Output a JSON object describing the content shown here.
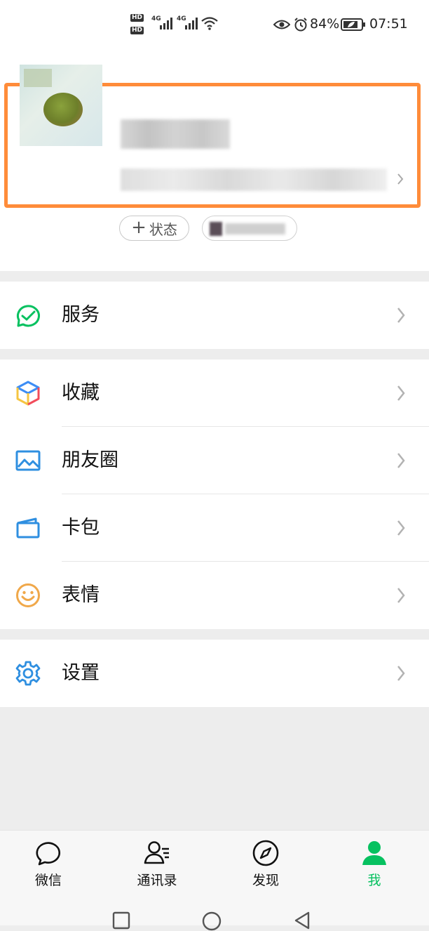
{
  "status_bar": {
    "hd1": "HD",
    "hd2": "HD",
    "net1": "4G",
    "net2": "4G",
    "battery": "84%",
    "time": "07:51"
  },
  "profile": {
    "status_button": "状态"
  },
  "menu": {
    "services": "服务",
    "favorites": "收藏",
    "moments": "朋友圈",
    "cards": "卡包",
    "stickers": "表情",
    "settings": "设置"
  },
  "tabbar": [
    {
      "label": "微信",
      "icon": "chat-icon"
    },
    {
      "label": "通讯录",
      "icon": "contacts-icon"
    },
    {
      "label": "发现",
      "icon": "compass-icon"
    },
    {
      "label": "我",
      "icon": "person-icon",
      "active": true
    }
  ],
  "colors": {
    "accent": "#07c160",
    "highlight_border": "#ff8c3a",
    "background": "#ededed"
  }
}
